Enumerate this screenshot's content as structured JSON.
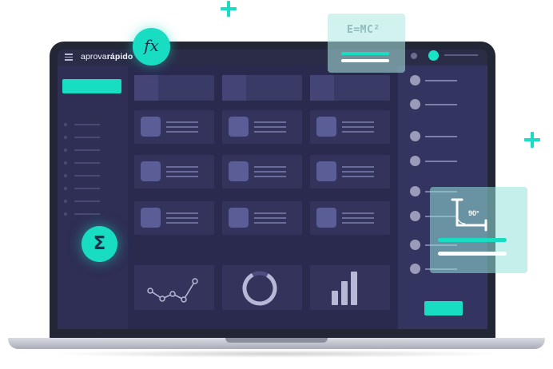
{
  "app": {
    "logo_prefix": "aprova",
    "logo_bold": "rápido"
  },
  "badges": {
    "function_symbol": "fx",
    "sum_symbol": "Σ"
  },
  "formula_card": {
    "formula": "E=MC²"
  },
  "angle_card": {
    "angle_label": "90°"
  },
  "colors": {
    "accent": "#19ddc3",
    "screen_bg": "#2a2a4e",
    "sidebar_bg": "#2f2e54",
    "card_bg": "#33335c",
    "thumb": "#5a5d96",
    "bezel": "#232635"
  },
  "icons": [
    "hamburger-menu-icon",
    "function-icon",
    "sigma-icon",
    "line-chart-icon",
    "donut-chart-icon",
    "bar-chart-icon",
    "right-angle-icon"
  ]
}
